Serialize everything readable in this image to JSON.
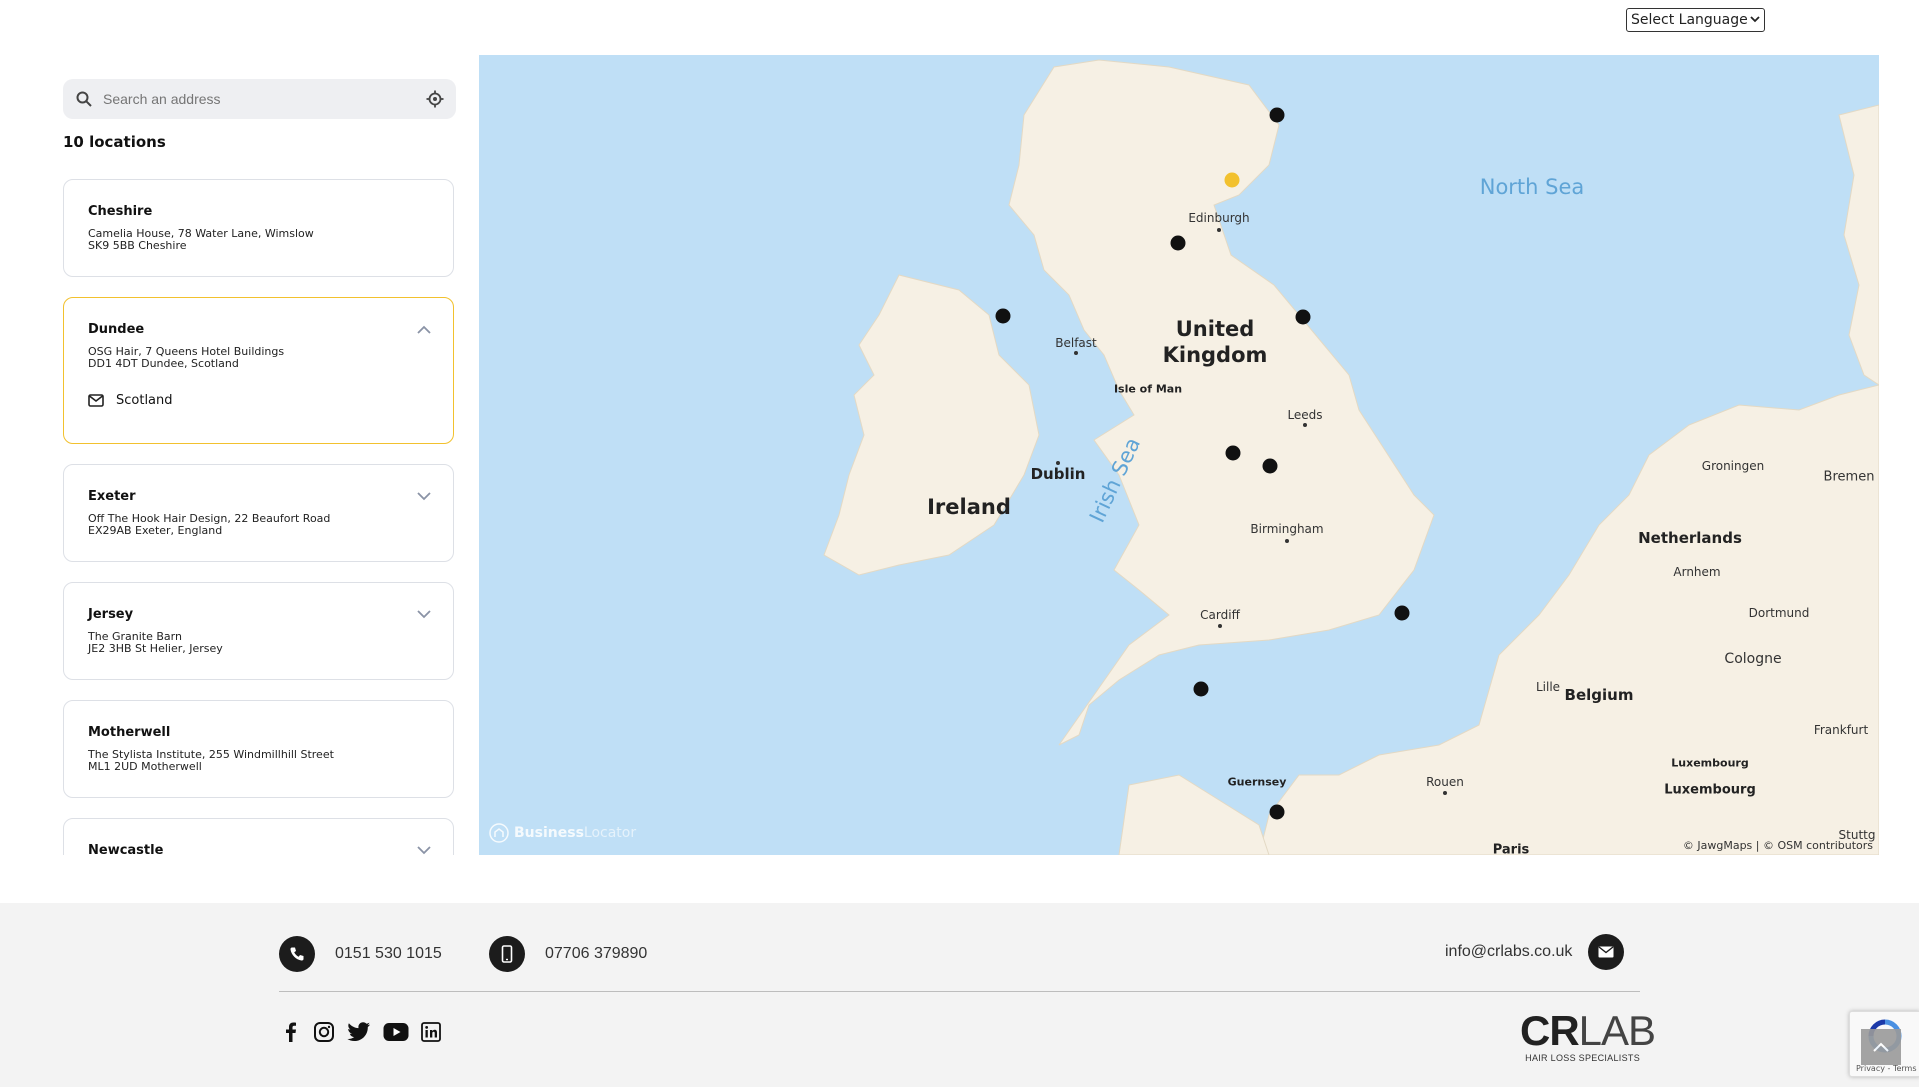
{
  "language_select": {
    "label": "Select Language"
  },
  "search": {
    "placeholder": "Search an address"
  },
  "locations_count": "10 locations",
  "locations": [
    {
      "name": "Cheshire",
      "address_line1": "Camelia House, 78 Water Lane, Wimslow",
      "address_line2": "SK9 5BB Cheshire"
    },
    {
      "name": "Dundee",
      "address_line1": "OSG Hair, 7 Queens Hotel Buildings",
      "address_line2": "DD1 4DT Dundee, Scotland",
      "region": "Scotland"
    },
    {
      "name": "Exeter",
      "address_line1": "Off The Hook Hair Design, 22 Beaufort Road",
      "address_line2": "EX29AB Exeter, England"
    },
    {
      "name": "Jersey",
      "address_line1": "The Granite Barn",
      "address_line2": "JE2 3HB St Helier, Jersey"
    },
    {
      "name": "Motherwell",
      "address_line1": "The Stylista Institute, 255 Windmillhill Street",
      "address_line2": "ML1 2UD Motherwell"
    },
    {
      "name": "Newcastle"
    }
  ],
  "map": {
    "labels": {
      "north_sea": "North Sea",
      "edinburgh": "Edinburgh",
      "united_kingdom_1": "United",
      "united_kingdom_2": "Kingdom",
      "belfast": "Belfast",
      "isle_of_man": "Isle of Man",
      "leeds": "Leeds",
      "irish_sea": "Irish Sea",
      "dublin": "Dublin",
      "ireland": "Ireland",
      "birmingham": "Birmingham",
      "cardiff": "Cardiff",
      "guernsey": "Guernsey",
      "rouen": "Rouen",
      "paris": "Paris",
      "groningen": "Groningen",
      "bremen": "Bremen",
      "netherlands": "Netherlands",
      "arnhem": "Arnhem",
      "dortmund": "Dortmund",
      "cologne": "Cologne",
      "belgium": "Belgium",
      "lille": "Lille",
      "frankfurt": "Frankfurt",
      "luxembourg_small": "Luxembourg",
      "luxembourg_city": "Luxembourg",
      "stuttg": "Stuttg"
    },
    "brand_prefix": "Business",
    "brand_suffix": "Locator",
    "attribution": "© JawgMaps | © OSM contributors"
  },
  "footer": {
    "phone": "0151 530 1015",
    "mobile": "07706 379890",
    "email": "info@crlabs.co.uk",
    "logo_main_bold": "CR",
    "logo_main_light": "LAB",
    "logo_tagline": "HAIR LOSS SPECIALISTS",
    "recaptcha_text": "Privacy - Terms"
  },
  "icons": {
    "search": "search-icon",
    "locate": "crosshair-icon",
    "mail": "envelope-icon",
    "phone": "phone-icon",
    "mobile": "mobile-icon",
    "facebook": "facebook-icon",
    "instagram": "instagram-icon",
    "twitter": "twitter-icon",
    "youtube": "youtube-icon",
    "linkedin": "linkedin-icon"
  },
  "colors": {
    "accent": "#f2c12e",
    "marker": "#111111",
    "sea": "#bfdff6",
    "land": "#f6f0e4"
  }
}
